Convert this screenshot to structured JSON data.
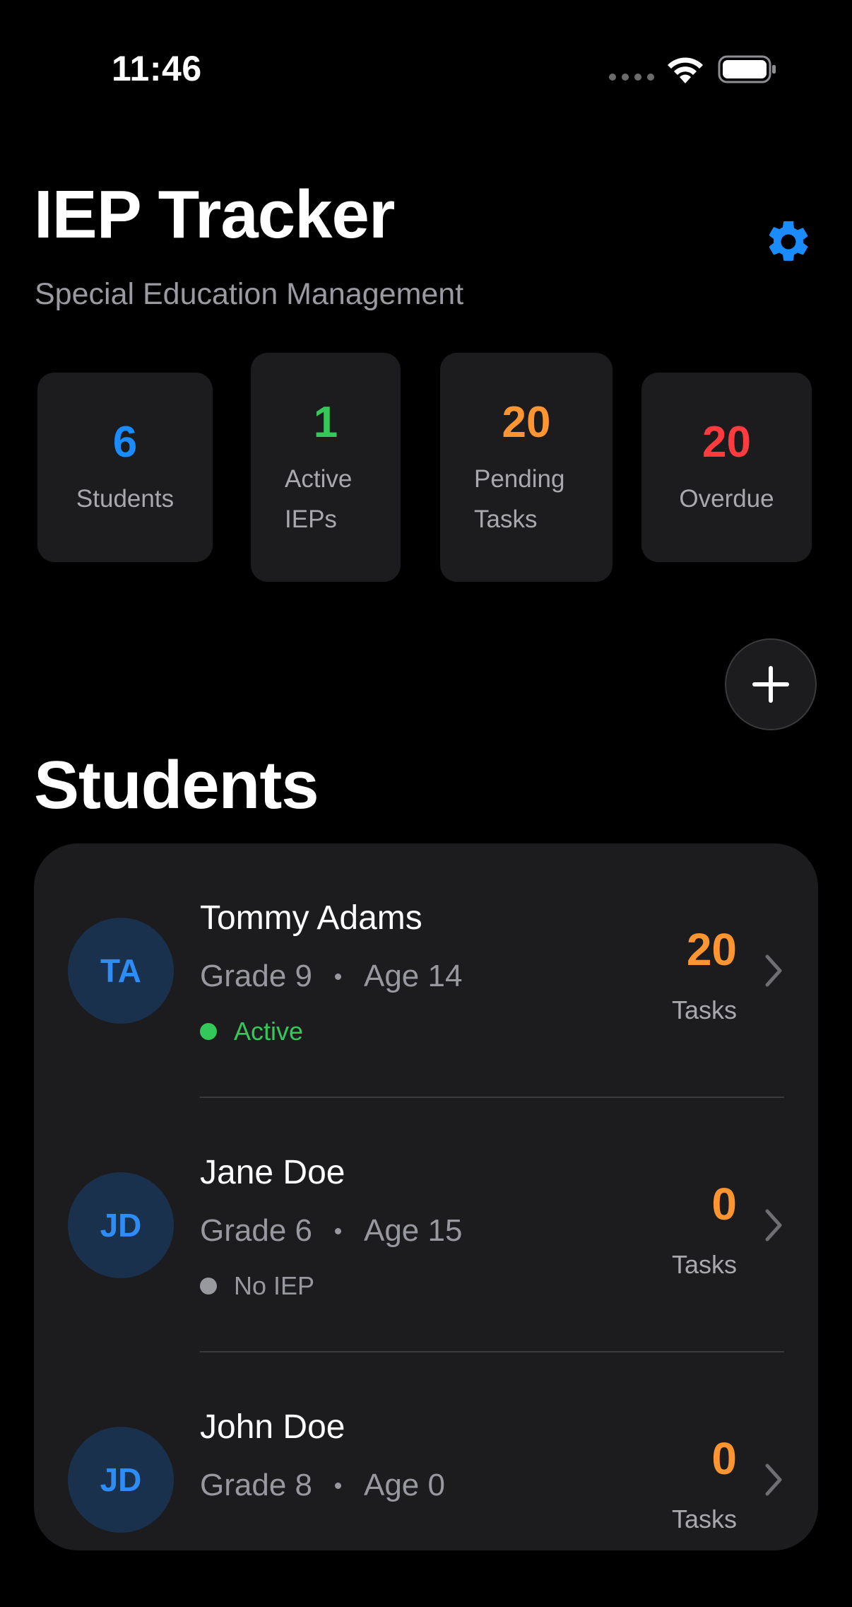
{
  "status_bar": {
    "time": "11:46"
  },
  "header": {
    "title": "IEP Tracker",
    "subtitle": "Special Education Management",
    "settings_icon": "gear-icon"
  },
  "stats": {
    "students": {
      "value": "6",
      "label": "Students",
      "color": "#1a8cff"
    },
    "active_ieps": {
      "value": "1",
      "label_line1": "Active",
      "label_line2": "IEPs",
      "color": "#34c759"
    },
    "pending_tasks": {
      "value": "20",
      "label_line1": "Pending",
      "label_line2": "Tasks",
      "color": "#ff9530"
    },
    "overdue": {
      "value": "20",
      "label": "Overdue",
      "color": "#ff3b3f"
    }
  },
  "add_button_icon": "plus-icon",
  "section": {
    "title": "Students"
  },
  "students": [
    {
      "initials": "TA",
      "name": "Tommy Adams",
      "grade": "Grade 9",
      "age": "Age 14",
      "status": "Active",
      "status_color": "#34c759",
      "task_count": "20",
      "task_label": "Tasks"
    },
    {
      "initials": "JD",
      "name": "Jane Doe",
      "grade": "Grade 6",
      "age": "Age 15",
      "status": "No IEP",
      "status_color": "#98989f",
      "task_count": "0",
      "task_label": "Tasks"
    },
    {
      "initials": "JD",
      "name": "John Doe",
      "grade": "Grade 8",
      "age": "Age 0",
      "task_count": "0",
      "task_label": "Tasks"
    }
  ],
  "colors": {
    "accent": "#1a8cff",
    "background": "#000000",
    "card": "#1c1c1e"
  }
}
